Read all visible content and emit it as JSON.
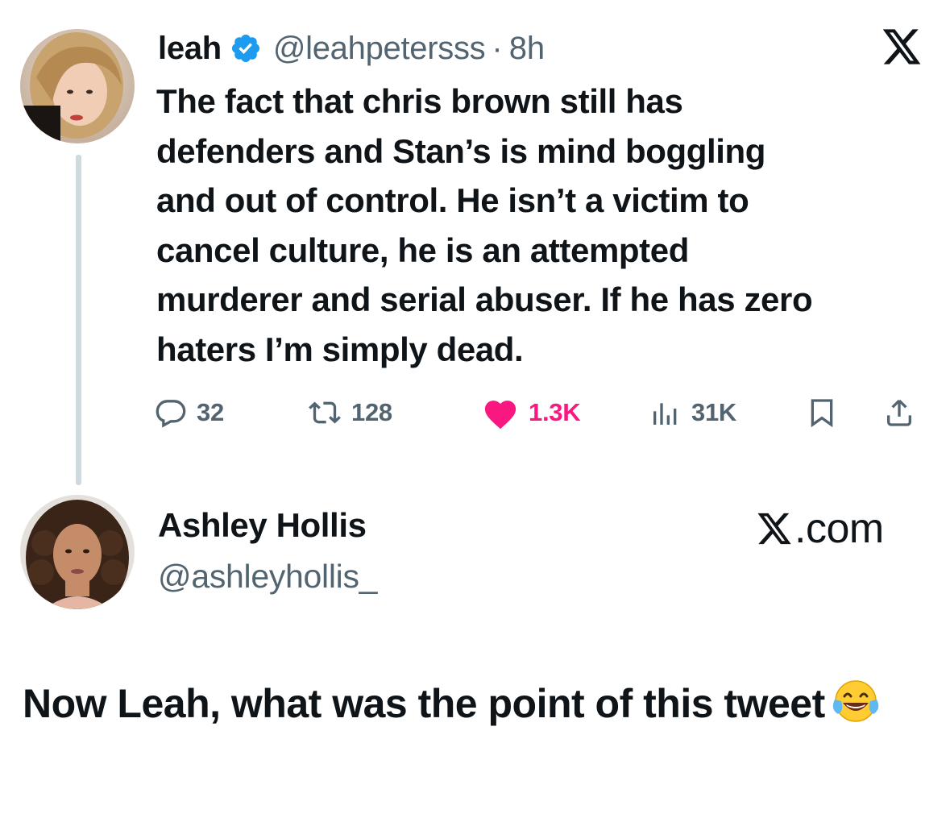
{
  "tweet": {
    "display_name": "leah",
    "verified_icon": "verified-badge-icon",
    "handle": "@leahpetersss",
    "separator": "·",
    "time": "8h",
    "text": "The fact that chris brown still has\ndefenders and Stan’s is mind boggling\nand out of control. He isn’t a victim to\ncancel culture, he is an attempted\nmurderer and serial abuser. If he has zero\nhaters I’m simply dead.",
    "actions": {
      "replies": "32",
      "retweets": "128",
      "likes": "1.3K",
      "views": "31K"
    },
    "colors": {
      "verified": "#1d9bf0",
      "like": "#f91880",
      "muted": "#536471",
      "thread_line": "#cfd9de"
    }
  },
  "footer_account": {
    "display_name": "Ashley Hollis",
    "handle": "@ashleyhollis_",
    "site": ".com"
  },
  "caption": {
    "text": "Now Leah, what was the point of this tweet",
    "emoji": "face-with-tears-of-joy"
  }
}
